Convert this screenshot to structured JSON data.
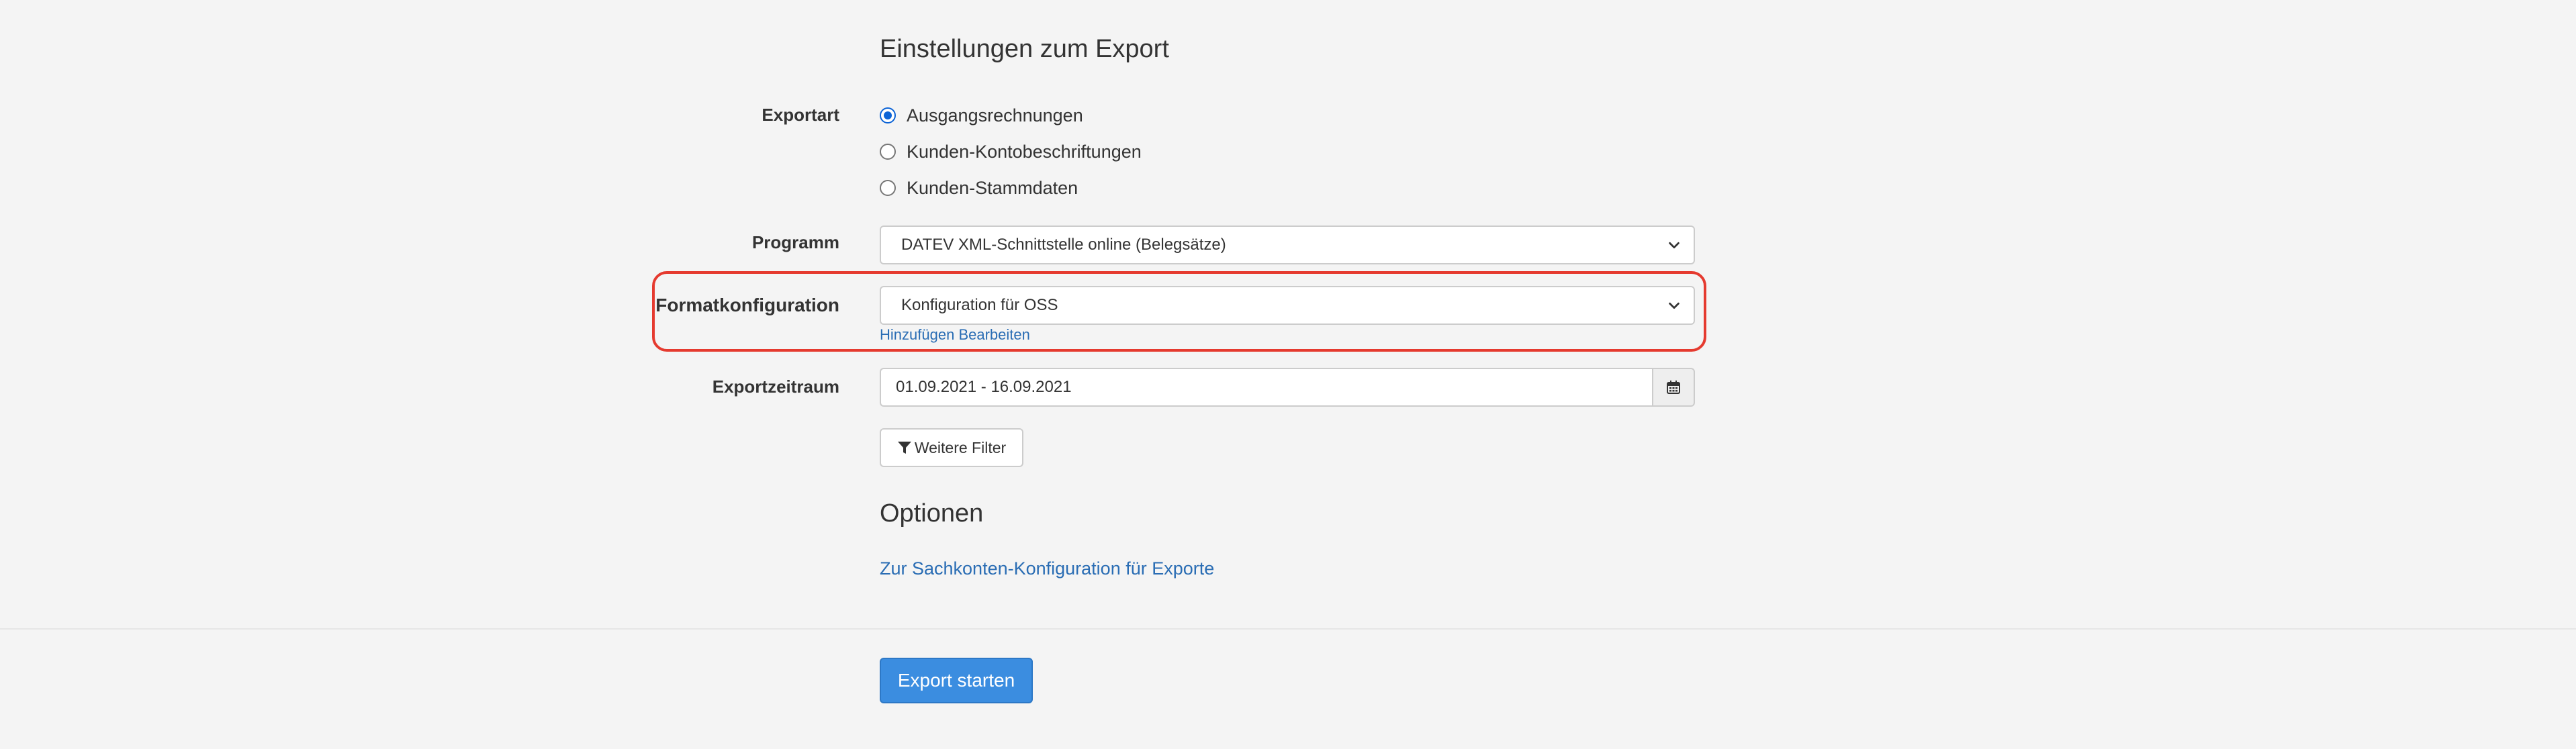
{
  "export_settings": {
    "heading": "Einstellungen zum Export",
    "export_type": {
      "label": "Exportart",
      "options": [
        {
          "label": "Ausgangsrechnungen",
          "checked": true
        },
        {
          "label": "Kunden-Kontobeschriftungen",
          "checked": false
        },
        {
          "label": "Kunden-Stammdaten",
          "checked": false
        }
      ]
    },
    "program": {
      "label": "Programm",
      "selected": "DATEV XML-Schnittstelle online (Belegsätze)"
    },
    "format_config": {
      "label": "Formatkonfiguration",
      "selected": "Konfiguration für OSS",
      "add_link": "Hinzufügen",
      "edit_link": "Bearbeiten"
    },
    "period": {
      "label": "Exportzeitraum",
      "value": "01.09.2021 - 16.09.2021",
      "icon": "calendar-icon"
    },
    "more_filters": {
      "label": "Weitere Filter",
      "icon": "filter-icon"
    }
  },
  "options": {
    "heading": "Optionen",
    "account_config_link": "Zur Sachkonten-Konfiguration für Exporte"
  },
  "footer": {
    "start_button": "Export starten"
  },
  "colors": {
    "background": "#f4f4f4",
    "link": "#2a6db4",
    "primary": "#3b8de0",
    "radio_checked": "#0b63d6",
    "highlight": "#e53a2f"
  }
}
